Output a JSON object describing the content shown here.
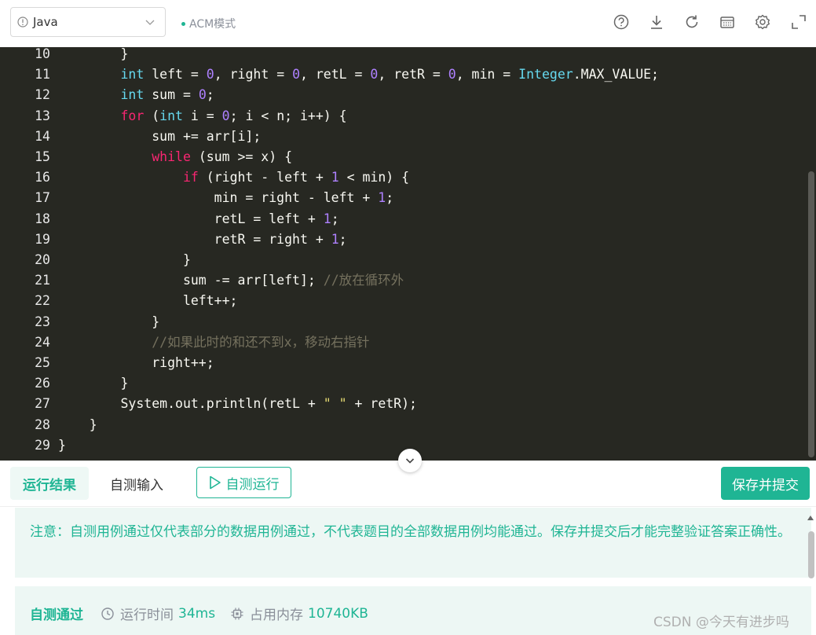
{
  "toolbar": {
    "language": "Java",
    "mode": "ACM模式",
    "icons": [
      "help-icon",
      "download-icon",
      "refresh-icon",
      "keyboard-icon",
      "settings-icon",
      "fullscreen-icon"
    ]
  },
  "code": {
    "lines": [
      {
        "n": "10",
        "tokens": [
          {
            "t": "        }",
            "c": "plain"
          }
        ]
      },
      {
        "n": "11",
        "tokens": [
          {
            "t": "        ",
            "c": "plain"
          },
          {
            "t": "int",
            "c": "type"
          },
          {
            "t": " left = ",
            "c": "plain"
          },
          {
            "t": "0",
            "c": "num"
          },
          {
            "t": ", right = ",
            "c": "plain"
          },
          {
            "t": "0",
            "c": "num"
          },
          {
            "t": ", retL = ",
            "c": "plain"
          },
          {
            "t": "0",
            "c": "num"
          },
          {
            "t": ", retR = ",
            "c": "plain"
          },
          {
            "t": "0",
            "c": "num"
          },
          {
            "t": ", min = ",
            "c": "plain"
          },
          {
            "t": "Integer",
            "c": "cls"
          },
          {
            "t": ".MAX_VALUE;",
            "c": "plain"
          }
        ]
      },
      {
        "n": "12",
        "tokens": [
          {
            "t": "        ",
            "c": "plain"
          },
          {
            "t": "int",
            "c": "type"
          },
          {
            "t": " sum = ",
            "c": "plain"
          },
          {
            "t": "0",
            "c": "num"
          },
          {
            "t": ";",
            "c": "plain"
          }
        ]
      },
      {
        "n": "13",
        "tokens": [
          {
            "t": "        ",
            "c": "plain"
          },
          {
            "t": "for",
            "c": "kw"
          },
          {
            "t": " (",
            "c": "plain"
          },
          {
            "t": "int",
            "c": "type"
          },
          {
            "t": " i = ",
            "c": "plain"
          },
          {
            "t": "0",
            "c": "num"
          },
          {
            "t": "; i < n; i++) {",
            "c": "plain"
          }
        ]
      },
      {
        "n": "14",
        "tokens": [
          {
            "t": "            sum += arr[i];",
            "c": "plain"
          }
        ]
      },
      {
        "n": "15",
        "tokens": [
          {
            "t": "            ",
            "c": "plain"
          },
          {
            "t": "while",
            "c": "kw"
          },
          {
            "t": " (sum >= x) {",
            "c": "plain"
          }
        ]
      },
      {
        "n": "16",
        "tokens": [
          {
            "t": "                ",
            "c": "plain"
          },
          {
            "t": "if",
            "c": "kw"
          },
          {
            "t": " (right - left + ",
            "c": "plain"
          },
          {
            "t": "1",
            "c": "num"
          },
          {
            "t": " < min) {",
            "c": "plain"
          }
        ]
      },
      {
        "n": "17",
        "tokens": [
          {
            "t": "                    min = right - left + ",
            "c": "plain"
          },
          {
            "t": "1",
            "c": "num"
          },
          {
            "t": ";",
            "c": "plain"
          }
        ]
      },
      {
        "n": "18",
        "tokens": [
          {
            "t": "                    retL = left + ",
            "c": "plain"
          },
          {
            "t": "1",
            "c": "num"
          },
          {
            "t": ";",
            "c": "plain"
          }
        ]
      },
      {
        "n": "19",
        "tokens": [
          {
            "t": "                    retR = right + ",
            "c": "plain"
          },
          {
            "t": "1",
            "c": "num"
          },
          {
            "t": ";",
            "c": "plain"
          }
        ]
      },
      {
        "n": "20",
        "tokens": [
          {
            "t": "                }",
            "c": "plain"
          }
        ]
      },
      {
        "n": "21",
        "tokens": [
          {
            "t": "                sum -= arr[left]; ",
            "c": "plain"
          },
          {
            "t": "//放在循环外",
            "c": "cmt"
          }
        ]
      },
      {
        "n": "22",
        "tokens": [
          {
            "t": "                left++;",
            "c": "plain"
          }
        ]
      },
      {
        "n": "23",
        "tokens": [
          {
            "t": "            }",
            "c": "plain"
          }
        ]
      },
      {
        "n": "24",
        "tokens": [
          {
            "t": "            ",
            "c": "plain"
          },
          {
            "t": "//如果此时的和还不到x，移动右指针",
            "c": "cmt"
          }
        ]
      },
      {
        "n": "25",
        "tokens": [
          {
            "t": "            right++;",
            "c": "plain"
          }
        ]
      },
      {
        "n": "26",
        "tokens": [
          {
            "t": "        }",
            "c": "plain"
          }
        ]
      },
      {
        "n": "27",
        "tokens": [
          {
            "t": "        System.out.println(retL + ",
            "c": "plain"
          },
          {
            "t": "\" \"",
            "c": "str"
          },
          {
            "t": " + retR);",
            "c": "plain"
          }
        ]
      },
      {
        "n": "28",
        "tokens": [
          {
            "t": "    }",
            "c": "plain"
          }
        ]
      },
      {
        "n": "29",
        "tokens": [
          {
            "t": "}",
            "c": "plain"
          }
        ]
      }
    ]
  },
  "tabs": {
    "result": "运行结果",
    "input": "自测输入",
    "run": "自测运行",
    "submit": "保存并提交"
  },
  "result": {
    "notice": "注意：自测用例通过仅代表部分的数据用例通过，不代表题目的全部数据用例均能通过。保存并提交后才能完整验证答案正确性。",
    "status": "自测通过",
    "time_label": "运行时间",
    "time_value": "34ms",
    "memory_label": "占用内存",
    "memory_value": "10740KB"
  },
  "watermark": "CSDN @今天有进步吗",
  "colors": {
    "accent": "#1fb594",
    "editor_bg": "#272822"
  }
}
